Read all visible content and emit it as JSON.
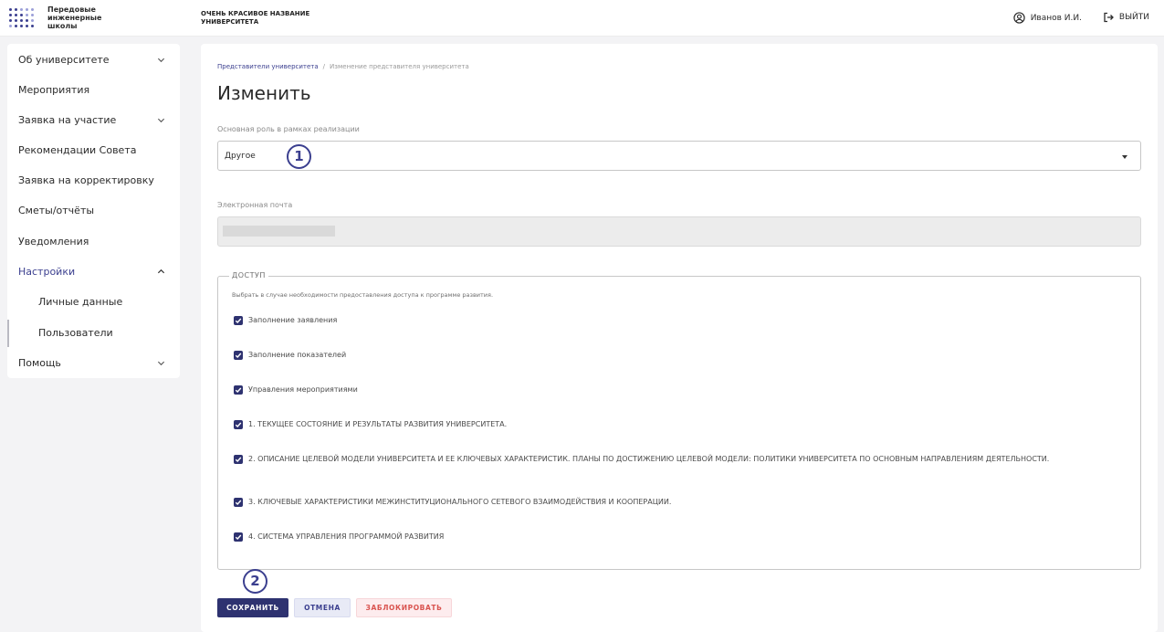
{
  "header": {
    "logo_text": "Передовые инженерные школы",
    "university_name": "ОЧЕНЬ КРАСИВОЕ НАЗВАНИЕ УНИВЕРСИТЕТА",
    "user_name": "Иванов И.И.",
    "logout_label": "ВЫЙТИ"
  },
  "sidebar": {
    "items": [
      {
        "label": "Об университете",
        "chevron": "down"
      },
      {
        "label": "Мероприятия"
      },
      {
        "label": "Заявка на участие",
        "chevron": "down"
      },
      {
        "label": "Рекомендации Совета"
      },
      {
        "label": "Заявка на корректировку"
      },
      {
        "label": "Сметы/отчёты"
      },
      {
        "label": "Уведомления"
      },
      {
        "label": "Настройки",
        "chevron": "up",
        "active": true
      },
      {
        "label": "Личные данные",
        "sub": true
      },
      {
        "label": "Пользователи",
        "sub": true,
        "current": true
      },
      {
        "label": "Помощь",
        "chevron": "down"
      }
    ]
  },
  "breadcrumb": {
    "link": "Представители университета",
    "separator": "/",
    "current": "Изменение представителя университета"
  },
  "page_title": "Изменить",
  "role_field": {
    "label": "Основная роль в рамках реализации",
    "value": "Другое"
  },
  "email_field": {
    "label": "Электронная почта"
  },
  "access": {
    "legend": "ДОСТУП",
    "hint": "Выбрать в случае необходимости предоставления доступа к программе развития.",
    "items": [
      {
        "label": "Заполнение заявления",
        "checked": true
      },
      {
        "label": "Заполнение показателей",
        "checked": true
      },
      {
        "label": "Управления мероприятиями",
        "checked": true
      },
      {
        "label": "1. ТЕКУЩЕЕ СОСТОЯНИЕ И РЕЗУЛЬТАТЫ РАЗВИТИЯ УНИВЕРСИТЕТА.",
        "checked": true
      },
      {
        "label": "2. ОПИСАНИЕ ЦЕЛЕВОЙ МОДЕЛИ УНИВЕРСИТЕТА И ЕЕ КЛЮЧЕВЫХ ХАРАКТЕРИСТИК. ПЛАНЫ ПО ДОСТИЖЕНИЮ ЦЕЛЕВОЙ МОДЕЛИ: ПОЛИТИКИ УНИВЕРСИТЕТА ПО ОСНОВНЫМ НАПРАВЛЕНИЯМ ДЕЯТЕЛЬНОСТИ.",
        "checked": true
      },
      {
        "label": "3. КЛЮЧЕВЫЕ ХАРАКТЕРИСТИКИ МЕЖИНСТИТУЦИОНАЛЬНОГО СЕТЕВОГО ВЗАИМОДЕЙСТВИЯ И КООПЕРАЦИИ.",
        "checked": true
      },
      {
        "label": "4. СИСТЕМА УПРАВЛЕНИЯ ПРОГРАММОЙ РАЗВИТИЯ",
        "checked": true
      }
    ]
  },
  "buttons": {
    "save": "СОХРАНИТЬ",
    "cancel": "ОТМЕНА",
    "block": "ЗАБЛОКИРОВАТЬ"
  },
  "callouts": {
    "one": "1",
    "two": "2"
  },
  "colors": {
    "accent": "#2e3270",
    "link": "#3b3f8f",
    "danger": "#d9534f"
  }
}
